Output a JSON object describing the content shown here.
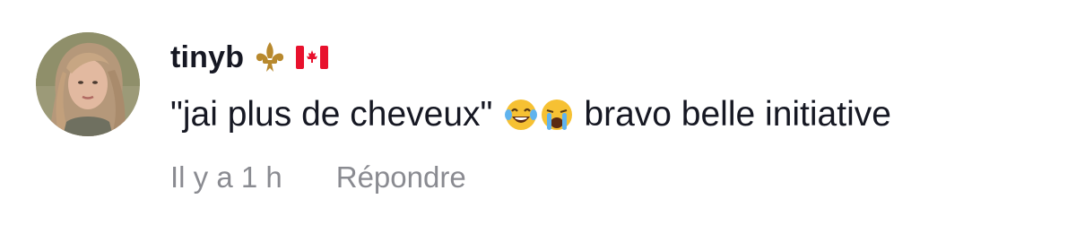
{
  "comment": {
    "username": "tinyb",
    "badges": [
      "fleur-de-lis-icon",
      "canada-flag-icon"
    ],
    "text_before_emoji": "\"jai plus de cheveux\"",
    "emojis": [
      "laughing-tears-emoji",
      "crying-emoji"
    ],
    "text_after_emoji": "bravo belle initiative",
    "timestamp": "Il y a 1 h",
    "reply_label": "Répondre"
  },
  "colors": {
    "text_primary": "#161823",
    "text_secondary": "#8a8b91",
    "fleur_de_lis": "#b8892e",
    "flag_red": "#e8112d"
  }
}
